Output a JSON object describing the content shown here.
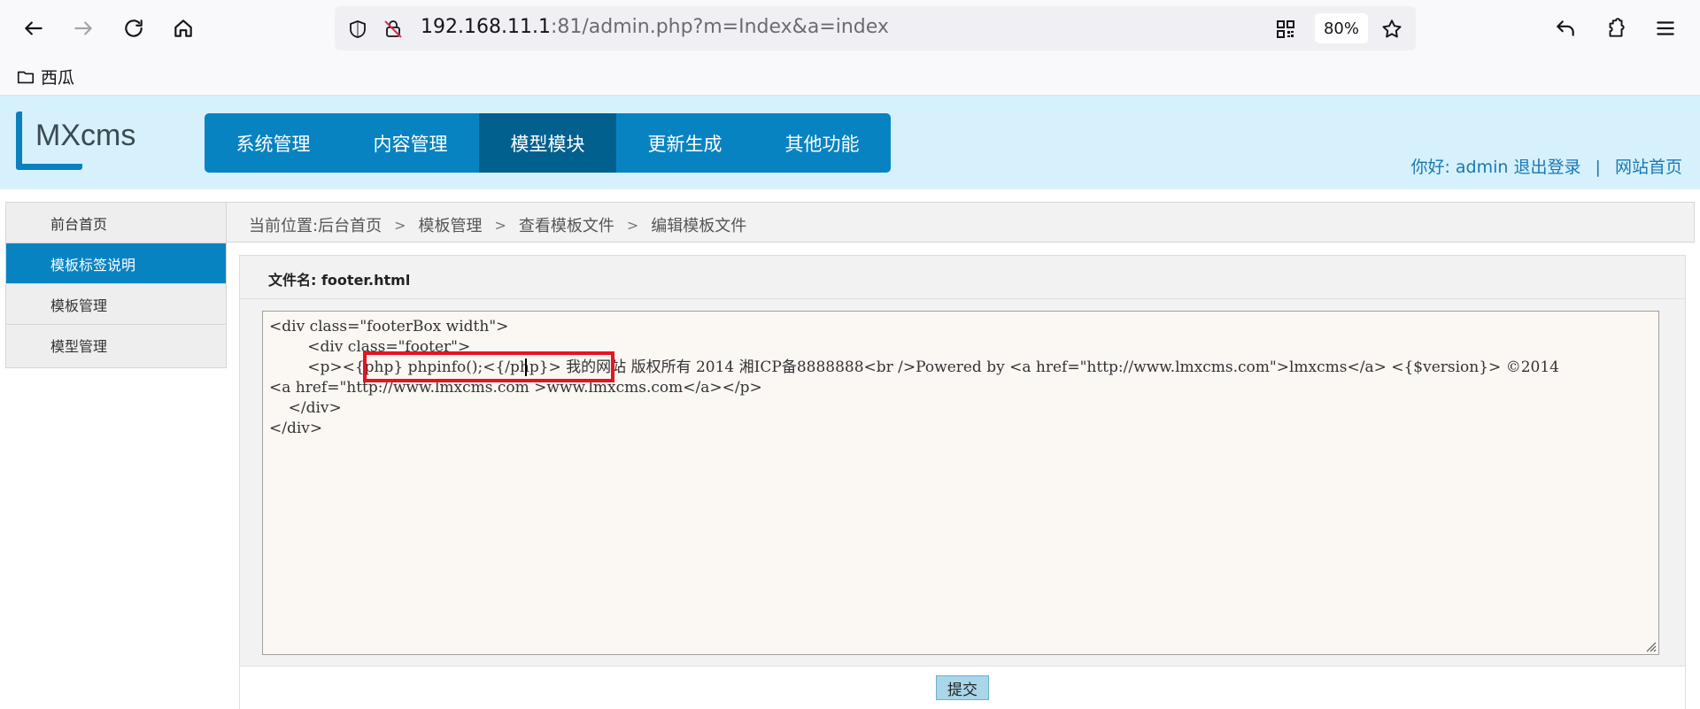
{
  "browser": {
    "url_host": "192.168.11.1",
    "url_rest": ":81/admin.php?m=Index&a=index",
    "zoom": "80%",
    "bookmarks": [
      {
        "label": "西瓜"
      }
    ]
  },
  "header": {
    "logo_text": "MXcms",
    "nav": [
      {
        "label": "系统管理",
        "active": false
      },
      {
        "label": "内容管理",
        "active": false
      },
      {
        "label": "模型模块",
        "active": true
      },
      {
        "label": "更新生成",
        "active": false
      },
      {
        "label": "其他功能",
        "active": false
      }
    ],
    "user_greeting": "你好: admin",
    "logout": "退出登录",
    "separator": "|",
    "site_home": "网站首页"
  },
  "sidebar": {
    "items": [
      {
        "label": "前台首页",
        "active": false
      },
      {
        "label": "模板标签说明",
        "active": true
      },
      {
        "label": "模板管理",
        "active": false
      },
      {
        "label": "模型管理",
        "active": false
      }
    ]
  },
  "breadcrumb": {
    "prefix": "当前位置: ",
    "items": [
      "后台首页",
      "模板管理",
      "查看模板文件",
      "编辑模板文件"
    ],
    "separator": ">"
  },
  "editor": {
    "file_label": "文件名: footer.html",
    "lines": [
      "<div class=\"footerBox width\">",
      "        <div class=\"footer\">",
      "        <p><{php} phpinfo();<{/php}> 我的网站 版权所有 2014 湘ICP备8888888<br />Powered by <a href=\"http://www.lmxcms.com\">lmxcms</a> <{$version}> ©2014",
      "<a href=\"http://www.lmxcms.com >www.lmxcms.com</a></p>",
      "    </div>",
      "</div>"
    ],
    "submit_label": "提交"
  },
  "colors": {
    "nav_bg": "#0883c2",
    "nav_active": "#02608f",
    "header_bg": "#d6f1fb",
    "highlight": "#e8131f"
  }
}
